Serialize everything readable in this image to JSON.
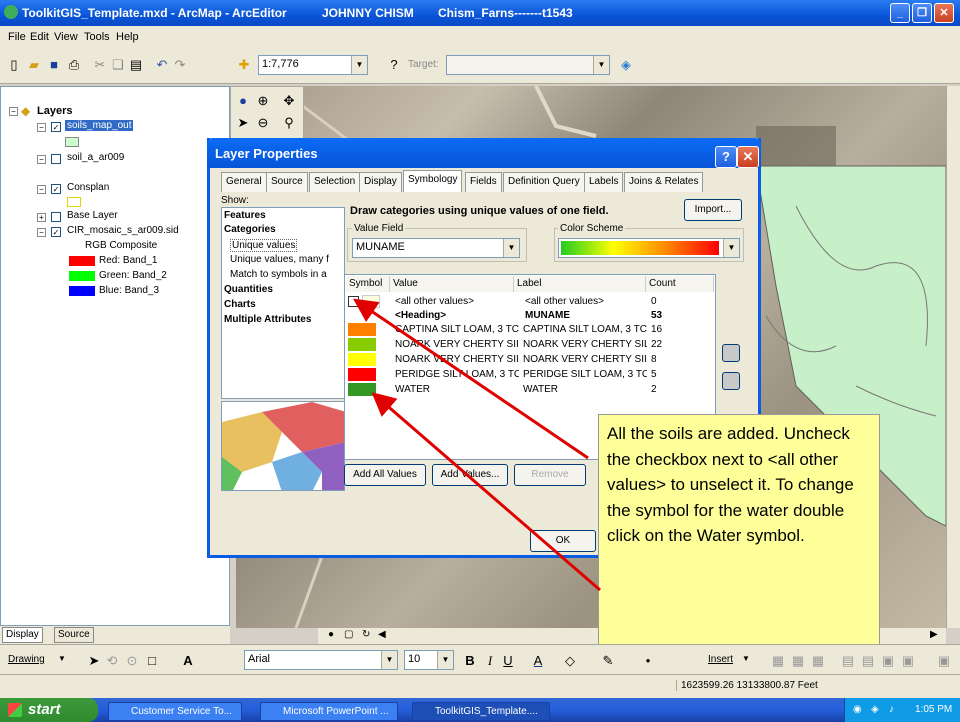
{
  "window": {
    "title": "ToolkitGIS_Template.mxd - ArcMap - ArcEditor",
    "user": "JOHNNY CHISM",
    "farm": "Chism_Farns-------t1543"
  },
  "menu": {
    "file": "File",
    "edit": "Edit",
    "view": "View",
    "tools": "Tools",
    "help": "Help"
  },
  "toolbar": {
    "scale": "1:7,776",
    "target_label": "Target:"
  },
  "toc": {
    "root": "Layers",
    "layers": [
      {
        "name": "soils_map_out",
        "checked": true
      },
      {
        "name": "soil_a_ar009",
        "checked": false
      },
      {
        "name": "Consplan",
        "checked": true
      },
      {
        "name": "Base Layer",
        "checked": false
      },
      {
        "name": "CIR_mosaic_s_ar009.sid",
        "checked": true
      }
    ],
    "rgb_label": "RGB Composite",
    "bands": [
      {
        "label": "Red:   Band_1",
        "color": "#ff0000"
      },
      {
        "label": "Green: Band_2",
        "color": "#00ff00"
      },
      {
        "label": "Blue:  Band_3",
        "color": "#0000ff"
      }
    ],
    "tabs": {
      "display": "Display",
      "source": "Source"
    }
  },
  "dialog": {
    "title": "Layer Properties",
    "tabs": [
      "General",
      "Source",
      "Selection",
      "Display",
      "Symbology",
      "Fields",
      "Definition Query",
      "Labels",
      "Joins & Relates"
    ],
    "active_tab": "Symbology",
    "show_label": "Show:",
    "show_items": [
      "Features",
      "Categories",
      "Unique values",
      "Unique values, many f",
      "Match to symbols in a",
      "Quantities",
      "Charts",
      "Multiple Attributes"
    ],
    "heading": "Draw categories using unique values of one field.",
    "import_label": "Import...",
    "value_field_label": "Value Field",
    "value_field": "MUNAME",
    "color_scheme_label": "Color Scheme",
    "columns": [
      "Symbol",
      "Value",
      "Label",
      "Count"
    ],
    "rows": [
      {
        "value": "<all other values>",
        "label": "<all other values>",
        "count": "0",
        "color": "#ffffe0",
        "bold": false
      },
      {
        "value": "<Heading>",
        "label": "MUNAME",
        "count": "53",
        "color": "",
        "bold": true
      },
      {
        "value": "CAPTINA SILT LOAM, 3 TC",
        "label": "CAPTINA SILT LOAM, 3 TC",
        "count": "16",
        "color": "#ff8000",
        "bold": false
      },
      {
        "value": "NOARK VERY CHERTY SII",
        "label": "NOARK VERY CHERTY SIL",
        "count": "22",
        "color": "#88cc00",
        "bold": false
      },
      {
        "value": "NOARK VERY CHERTY SII",
        "label": "NOARK VERY CHERTY SII",
        "count": "8",
        "color": "#ffff00",
        "bold": false
      },
      {
        "value": "PERIDGE SILT LOAM, 3 TC",
        "label": "PERIDGE SILT LOAM, 3 TC",
        "count": "5",
        "color": "#ff0000",
        "bold": false
      },
      {
        "value": "WATER",
        "label": "WATER",
        "count": "2",
        "color": "#339922",
        "bold": false
      }
    ],
    "buttons": {
      "add_all": "Add All Values",
      "add": "Add Values...",
      "remove": "Remove",
      "ok": "OK"
    }
  },
  "callout": "All the soils are added. Uncheck the checkbox next to <all other values> to unselect it. To change the symbol for the water double click on the Water symbol.",
  "drawbar": {
    "drawing": "Drawing",
    "font": "Arial",
    "size": "10",
    "insert": "Insert"
  },
  "status": {
    "coords": "1623599.26  13133800.87 Feet"
  },
  "taskbar": {
    "start": "start",
    "tasks": [
      "Customer Service To...",
      "Microsoft PowerPoint ...",
      "ToolkitGIS_Template...."
    ],
    "clock": "1:05 PM"
  }
}
